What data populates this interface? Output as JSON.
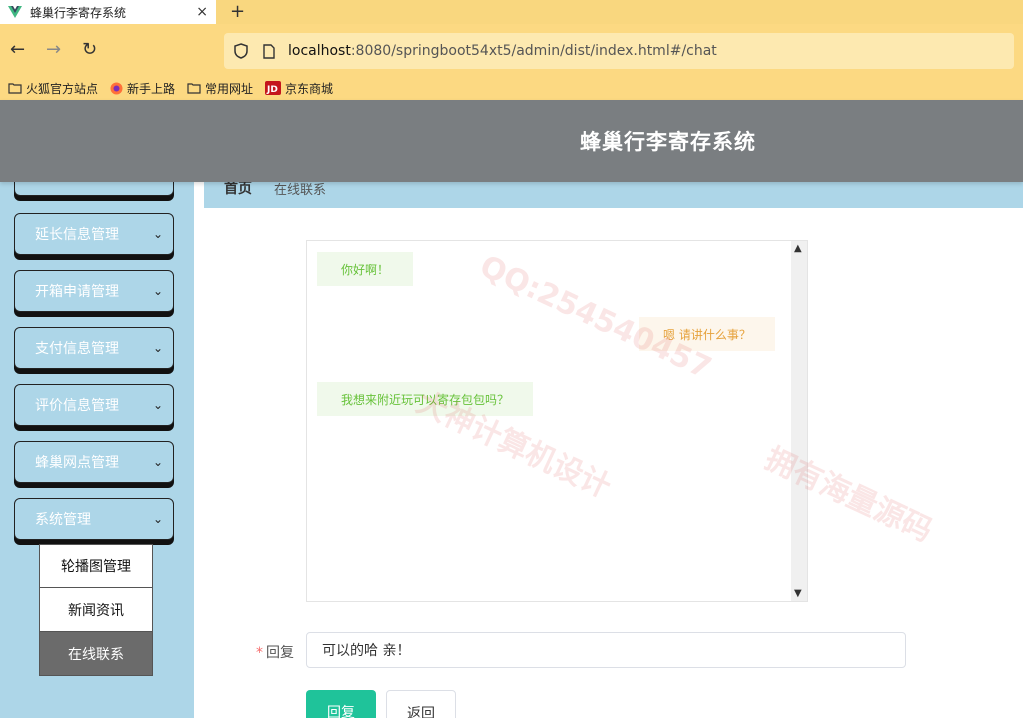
{
  "browser": {
    "tab_title": "蜂巢行李寄存系统",
    "tab_close": "×",
    "new_tab": "+",
    "url_host": "localhost",
    "url_rest": ":8080/springboot54xt5/admin/dist/index.html#/chat",
    "bookmarks": [
      "火狐官方站点",
      "新手上路",
      "常用网址",
      "京东商城"
    ]
  },
  "app": {
    "title": "蜂巢行李寄存系统"
  },
  "sidebar": {
    "items": [
      {
        "label": "延长信息管理"
      },
      {
        "label": "开箱申请管理"
      },
      {
        "label": "支付信息管理"
      },
      {
        "label": "评价信息管理"
      },
      {
        "label": "蜂巢网点管理"
      },
      {
        "label": "系统管理"
      }
    ],
    "submenu": [
      {
        "label": "轮播图管理"
      },
      {
        "label": "新闻资讯"
      },
      {
        "label": "在线联系"
      }
    ]
  },
  "breadcrumb": {
    "home": "首页",
    "current": "在线联系"
  },
  "chat": {
    "messages": [
      {
        "side": "left",
        "text": "你好啊！"
      },
      {
        "side": "right",
        "text": "嗯 请讲什么事？"
      },
      {
        "side": "left",
        "text": "我想来附近玩可以寄存包包吗？"
      }
    ]
  },
  "reply": {
    "required_mark": "*",
    "label": "回复",
    "value": "可以的哈 亲！"
  },
  "buttons": {
    "submit": "回复",
    "back": "返回"
  },
  "watermark": {
    "text1": "QQ:254540457",
    "text2": "大神计算机设计",
    "text3": "拥有海量源码"
  },
  "colors": {
    "header_bg": "#7a7e81",
    "sidebar_bg": "#add6e8",
    "primary": "#1fc39a"
  }
}
